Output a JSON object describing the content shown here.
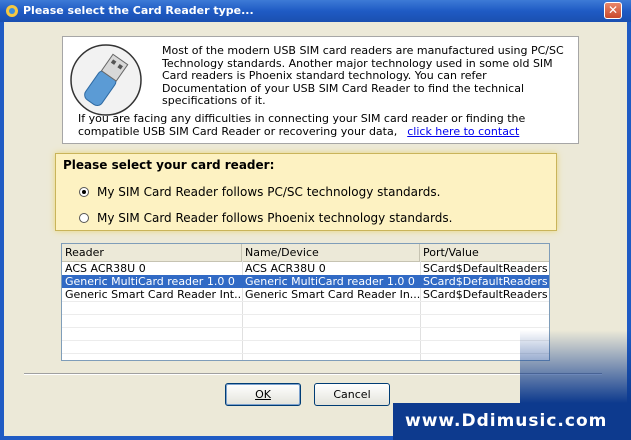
{
  "window": {
    "title": "Please select the Card Reader type...",
    "close_label": "✕"
  },
  "info": {
    "paragraph1": "Most of the modern USB SIM card readers are manufactured using PC/SC Technology standards. Another major technology used in some old SIM Card readers is Phoenix standard technology. You can refer Documentation of your USB SIM Card Reader to find the technical specifications of it.",
    "paragraph2": "If you are facing any difficulties in connecting your SIM card reader or finding the compatible USB SIM Card Reader or recovering your data,",
    "link_text": "click here to contact"
  },
  "reader_group": {
    "title": "Please select your card reader:",
    "options": [
      {
        "label": "My SIM Card Reader follows PC/SC technology standards.",
        "checked": true
      },
      {
        "label": "My SIM Card Reader follows Phoenix technology standards.",
        "checked": false
      }
    ]
  },
  "table": {
    "columns": [
      "Reader",
      "Name/Device",
      "Port/Value"
    ],
    "rows": [
      [
        "ACS ACR38U 0",
        "ACS ACR38U 0",
        "SCard$DefaultReaders"
      ],
      [
        "Generic MultiCard reader 1.0 0",
        "Generic MultiCard reader 1.0 0",
        "SCard$DefaultReaders"
      ],
      [
        "Generic Smart Card Reader Int...",
        "Generic Smart Card Reader In...",
        "SCard$DefaultReaders"
      ]
    ],
    "selected_row": 1
  },
  "buttons": {
    "ok": "OK",
    "cancel": "Cancel"
  },
  "watermark": {
    "text": "www.Ddimusic.com"
  },
  "colors": {
    "title_bar": "#1f5bc4",
    "selection": "#316ac5",
    "group_background": "#fdf2c2"
  }
}
